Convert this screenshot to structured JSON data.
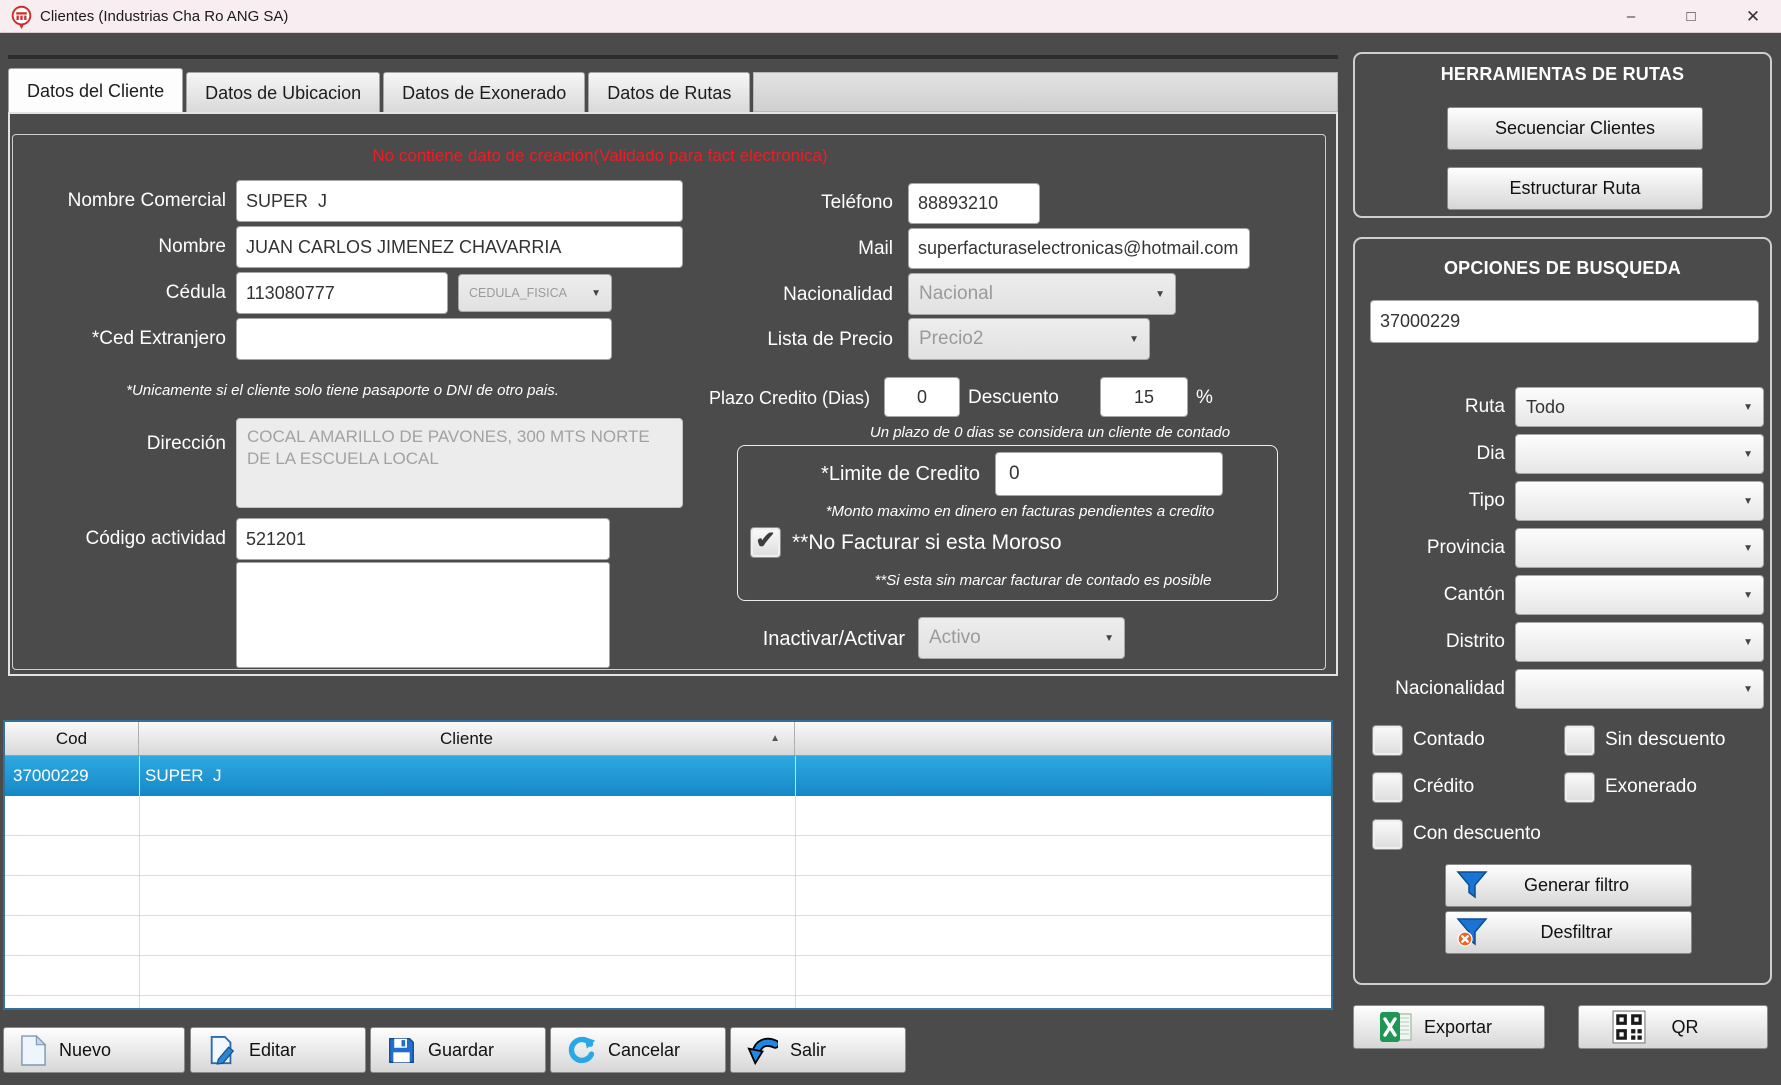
{
  "window": {
    "title": "Clientes (Industrias Cha Ro ANG SA)",
    "minimize": "–",
    "maximize": "□",
    "close": "✕"
  },
  "icons": {
    "dropdown": "▼",
    "check": "✔",
    "sort_asc": "▲"
  },
  "tabs": {
    "t0": "Datos del Cliente",
    "t1": "Datos de Ubicacion",
    "t2": "Datos de Exonerado",
    "t3": "Datos de Rutas"
  },
  "form": {
    "warning": "No contiene dato de creación(Validado para fact electronica)",
    "nombre_comercial": {
      "label": "Nombre Comercial",
      "value": "SUPER  J"
    },
    "nombre": {
      "label": "Nombre",
      "value": "JUAN CARLOS JIMENEZ CHAVARRIA"
    },
    "cedula": {
      "label": "Cédula",
      "value": "113080777",
      "tipo": "CEDULA_FISICA"
    },
    "ced_extranjero": {
      "label": "*Ced Extranjero",
      "value": "",
      "note": "*Unicamente si el cliente solo tiene pasaporte o DNI de otro pais."
    },
    "direccion": {
      "label": "Dirección",
      "value": "COCAL AMARILLO DE PAVONES, 300 MTS NORTE DE LA ESCUELA LOCAL"
    },
    "codigo_actividad": {
      "label": "Código actividad",
      "value": "521201"
    },
    "telefono": {
      "label": "Teléfono",
      "value": "88893210"
    },
    "mail": {
      "label": "Mail",
      "value": "superfacturaselectronicas@hotmail.com"
    },
    "nacionalidad": {
      "label": "Nacionalidad",
      "value": "Nacional"
    },
    "lista_precio": {
      "label": "Lista de Precio",
      "value": "Precio2"
    },
    "plazo_credito": {
      "label": "Plazo Credito (Dias)",
      "value": "0"
    },
    "descuento": {
      "label": "Descuento",
      "value": "15",
      "suffix": "%"
    },
    "plazo_note": "Un plazo de 0 dias se considera un cliente de contado",
    "limite_credito": {
      "label": "*Limite de Credito",
      "value": "0",
      "note": "*Monto maximo en dinero en facturas pendientes a credito"
    },
    "no_facturar": {
      "label": "**No Facturar si esta Moroso",
      "note": "**Si esta sin marcar facturar de contado es posible"
    },
    "estado": {
      "label": "Inactivar/Activar",
      "value": "Activo"
    }
  },
  "table": {
    "col_cod": "Cod",
    "col_cliente": "Cliente",
    "row": {
      "cod": "37000229",
      "cliente": "SUPER  J"
    }
  },
  "actions": {
    "nuevo": "Nuevo",
    "editar": "Editar",
    "guardar": "Guardar",
    "cancelar": "Cancelar",
    "salir": "Salir"
  },
  "sidebar": {
    "rutas_title": "HERRAMIENTAS DE RUTAS",
    "btn_secuenciar": "Secuenciar Clientes",
    "btn_estructurar": "Estructurar Ruta",
    "busqueda_title": "OPCIONES DE BUSQUEDA",
    "search_value": "37000229",
    "f_ruta": {
      "label": "Ruta",
      "value": "Todo"
    },
    "f_dia": {
      "label": "Dia",
      "value": ""
    },
    "f_tipo": {
      "label": "Tipo",
      "value": ""
    },
    "f_provincia": {
      "label": "Provincia",
      "value": ""
    },
    "f_canton": {
      "label": "Cantón",
      "value": ""
    },
    "f_distrito": {
      "label": "Distrito",
      "value": ""
    },
    "f_nacionalidad": {
      "label": "Nacionalidad",
      "value": ""
    },
    "cb_contado": "Contado",
    "cb_sin_descuento": "Sin descuento",
    "cb_credito": "Crédito",
    "cb_exonerado": "Exonerado",
    "cb_con_descuento": "Con descuento",
    "btn_generar": "Generar filtro",
    "btn_desfiltrar": "Desfiltrar",
    "btn_exportar": "Exportar",
    "btn_qr": "QR"
  }
}
